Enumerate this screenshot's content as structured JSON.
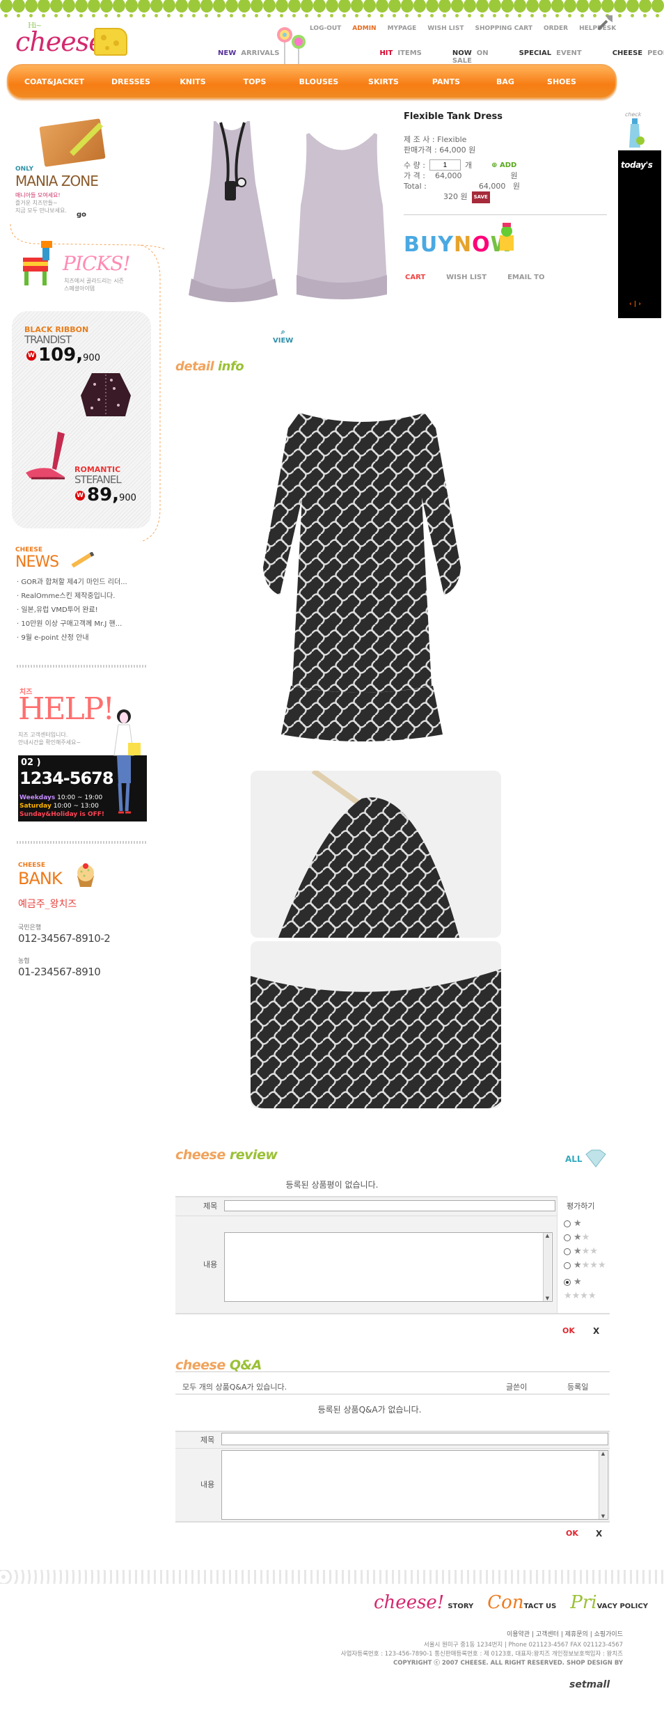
{
  "header": {
    "logo_greet": "Hi~",
    "logo_text": "cheese!",
    "top_menu": [
      {
        "label": "LOG-OUT"
      },
      {
        "label": "ADMIN"
      },
      {
        "label": "MYPAGE"
      },
      {
        "label": "WISH LIST"
      },
      {
        "label": "SHOPPING CART"
      },
      {
        "label": "ORDER"
      },
      {
        "label": "HELPDESK"
      }
    ],
    "sub_menu": [
      {
        "bold": "NEW",
        "label": "ARRIVALS"
      },
      {
        "bold": "HIT",
        "label": "ITEMS"
      },
      {
        "bold": "NOW",
        "label": "ON SALE"
      },
      {
        "bold": "SPECIAL",
        "label": "EVENT"
      },
      {
        "bold": "CHEESE",
        "label": "PEOPLE"
      }
    ],
    "nav": [
      "COAT&JACKET",
      "DRESSES",
      "KNITS",
      "TOPS",
      "BLOUSES",
      "SKIRTS",
      "PANTS",
      "BAG",
      "SHOES"
    ]
  },
  "sidebar": {
    "mania": {
      "only": "ONLY",
      "title": "MANIA ZONE",
      "sub1": "매니아들 모여세요!",
      "sub2": "즐거운 치즈만들~",
      "sub3": "지금 모두 만나보세요.",
      "go": "go"
    },
    "picks": {
      "title": "PICKS!",
      "sub1": "치즈에서 골라드리는 시즌",
      "sub2": "스페셜아이템"
    },
    "ribbon": {
      "item1_brand": "BLACK RIBBON",
      "item1_name": "TRANDIST",
      "item1_price_big": "109,",
      "item1_price_small": "900",
      "item2_brand": "ROMANTIC",
      "item2_name": "STEFANEL",
      "item2_price_big": "89,",
      "item2_price_small": "900",
      "won": "W"
    },
    "news": {
      "label": "CHEESE",
      "title": "NEWS",
      "items": [
        "GOR과 합쳐할 제4기 마인드 리더...",
        "RealOmme스킨 제작중입니다.",
        "일본,유럽 VMD투어 완료!",
        "10만원 이상 구매고객께 Mr.J 핸...",
        "9월 e-point 산정 안내"
      ]
    },
    "help": {
      "brand": "치즈",
      "title": "HELP!",
      "sub1": "치즈 고객센터입니다.",
      "sub2": "안내시간을 확인해주세요~",
      "area": "02 )",
      "tel": "1234-5678",
      "weekdays_label": "Weekdays",
      "weekdays": "10:00 ~ 19:00",
      "saturday_label": "Saturday",
      "saturday": "10:00 ~ 13:00",
      "holiday": "Sunday&Holiday is OFF!"
    },
    "bank": {
      "label": "CHEESE",
      "title": "BANK",
      "owner": "예금주_왕치즈",
      "bank1": "국민은행",
      "num1": "012-34567-8910-2",
      "bank2": "농협",
      "num2": "01-234567-8910"
    }
  },
  "product": {
    "title": "Flexible Tank Dress",
    "maker_label": "제 조 사 :",
    "maker": "Flexible",
    "sale_label": "판매가격 :",
    "sale_price": "64,000 원",
    "qty_label": "수  량 :",
    "qty_value": "1",
    "qty_unit": "개",
    "add_label": "ADD",
    "price_label": "가  격 :",
    "price": "64,000",
    "price_unit": "원",
    "total_label": "Total :",
    "total": "64,000",
    "total_unit": "원",
    "points": "320",
    "points_unit": "원",
    "save_label": "SAVE",
    "view_label": "VIEW",
    "buynow": {
      "b": "BUY",
      "n": "N",
      "o": "O",
      "w": "W"
    },
    "actions": [
      "CART",
      "WISH LIST",
      "EMAIL TO"
    ]
  },
  "today": {
    "check": "check",
    "label": "today's",
    "nav": "‹ | ›"
  },
  "detail": {
    "a": "detail",
    "b": "info"
  },
  "review": {
    "head_a": "cheese",
    "head_b": "review",
    "all": "ALL",
    "empty": "등록된 상품평이 없습니다.",
    "title_label": "제목",
    "rating_label": "평가하기",
    "content_label": "내용",
    "ok": "OK",
    "x": "X",
    "stars": [
      {
        "on": "★",
        "off": ""
      },
      {
        "on": "★",
        "off": "★"
      },
      {
        "on": "★",
        "off": "★★"
      },
      {
        "on": "★",
        "off": "★★★"
      },
      {
        "on": "★",
        "off": "★★★★"
      }
    ],
    "selected_rating": 5
  },
  "qna": {
    "head_a": "cheese",
    "head_b": "Q&A",
    "summary": "모두 개의 상품Q&A가 있습니다.",
    "writer_col": "글쓴이",
    "date_col": "등록일",
    "empty": "등록된 상품Q&A가 없습니다.",
    "title_label": "제목",
    "content_label": "내용",
    "ok": "OK",
    "x": "X"
  },
  "footer": {
    "links": [
      {
        "big": "cheese!",
        "small": "STORY"
      },
      {
        "big": "Con",
        "small": "TACT US"
      },
      {
        "big": "Pri",
        "small": "VACY POLICY"
      }
    ],
    "util": "이용약관  |  고객센터  |  제휴문의  |  쇼핑가이드",
    "info1": "서울시 원미구 중1동 1234번지 | Phone 021123-4567   FAX 021123-4567",
    "info2": "사업자등록번호 : 123-456-7890-1 통신판매등록번호 : 제 0123호, 대표자:왕치즈   개인정보보호책임자 : 왕치즈",
    "copyright": "COPYRIGHT ⓒ 2007 CHEESE. ALL RIGHT RESERVED. SHOP DESIGN BY",
    "brand": "setmall"
  },
  "colors": {
    "orange": "#f77d14",
    "green": "#9cc93a",
    "pink": "#d4286e"
  }
}
